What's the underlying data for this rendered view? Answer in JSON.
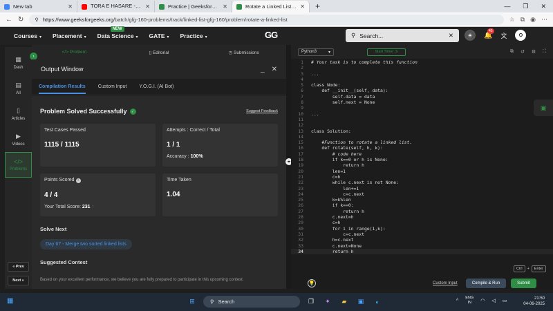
{
  "browser": {
    "tabs": [
      {
        "title": "New tab",
        "color": "#4285f4"
      },
      {
        "title": "TORA E HASARE - হাসির না ভো",
        "color": "#ff0000"
      },
      {
        "title": "Practice | GeeksforGeeks | A comp",
        "color": "#2f8d46"
      },
      {
        "title": "Rotate a Linked List | Practice | Ge",
        "color": "#2f8d46"
      }
    ],
    "url_host": "https://www.geeksforgeeks.org",
    "url_path": "/batch/gfg-160-problems/track/linked-list-gfg-160/problem/rotate-a-linked-list"
  },
  "nav": {
    "items": [
      "Courses",
      "Placement",
      "Data Science",
      "GATE",
      "Practice"
    ],
    "new_badge": "NEW",
    "logo": "GG",
    "search_placeholder": "Search...",
    "notifications": "45",
    "avatar": "O"
  },
  "sidebar": {
    "items": [
      "Dash",
      "All",
      "Articles",
      "Videos",
      "Problems"
    ],
    "prev": "« Prev",
    "next": "Next »"
  },
  "problem_tabs": [
    "Problem",
    "Editorial",
    "Submissions"
  ],
  "output": {
    "title": "Output Window",
    "tabs": [
      "Compilation Results",
      "Custom Input",
      "Y.O.G.I. (AI Bot)"
    ],
    "status": "Problem Solved Successfully",
    "feedback": "Suggest Feedback",
    "cards": {
      "tests_label": "Test Cases Passed",
      "tests_value": "1115 / 1115",
      "attempts_label": "Attempts : Correct / Total",
      "attempts_value": "1 / 1",
      "accuracy_label": "Accuracy :",
      "accuracy_value": "100%",
      "points_label": "Points Scored",
      "points_value": "4 / 4",
      "total_label": "Your Total Score:",
      "total_value": "231",
      "time_label": "Time Taken",
      "time_value": "1.04"
    },
    "solve_next": "Solve Next",
    "next_problem": "Day 67 - Merge two sorted linked lists",
    "suggested": "Suggested Contest",
    "suggested_text": "Based on your excellent performance, we believe you are fully prepared to participate in this upcoming contest."
  },
  "editor": {
    "language": "Python3",
    "timer": "Start Timer",
    "shortcut_ctrl": "Ctrl",
    "shortcut_plus": "+",
    "shortcut_enter": "Enter",
    "custom_input": "Custom Input",
    "compile": "Compile & Run",
    "submit": "Submit",
    "lines": [
      "# Your task is to complete this function",
      "",
      "...",
      "",
      "class Node:",
      "    def __init__(self, data):",
      "        self.data = data",
      "        self.next = None",
      "",
      "...",
      "",
      "",
      "class Solution:",
      "",
      "    #Function to rotate a linked list.",
      "    def rotate(self, h, k):",
      "        # code here",
      "        if k==0 or h is None:",
      "            return h",
      "        len=1",
      "        c=h",
      "        while c.next is not None:",
      "            len+=1",
      "            c=c.next",
      "        k=k%len",
      "        if k==0:",
      "            return h",
      "        c.next=h",
      "        c=h",
      "        for i in range(1,k):",
      "            c=c.next",
      "        h=c.next",
      "        c.next=None",
      "        return h"
    ]
  },
  "taskbar": {
    "search": "Search",
    "lang1": "ENG",
    "lang2": "IN",
    "time": "21:50",
    "date": "04-06-2025"
  }
}
